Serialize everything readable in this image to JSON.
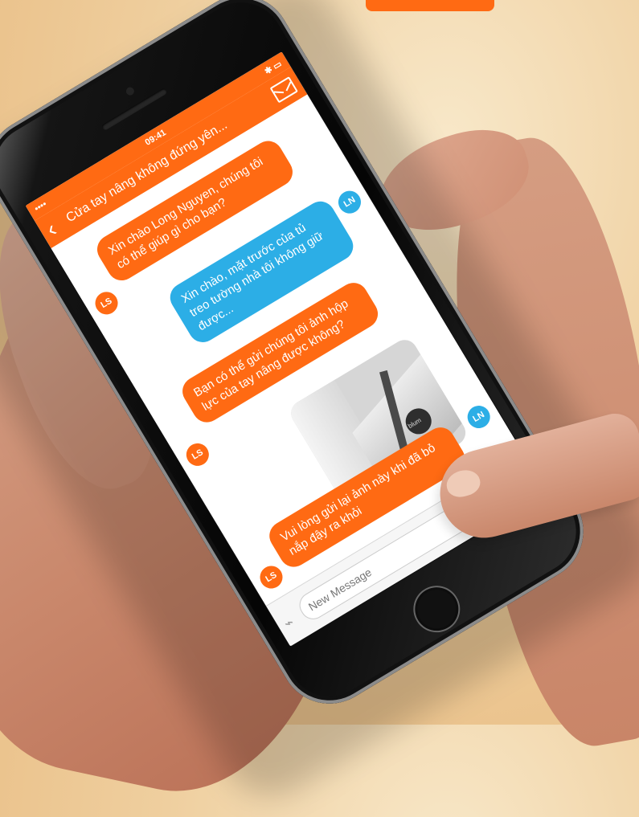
{
  "status": {
    "signal": "•••• ",
    "time": "09:41",
    "battery": "✱ ▭"
  },
  "header": {
    "back": "‹",
    "title": "Cửa tay nâng không đứng yên..."
  },
  "avatars": {
    "staff": "LS",
    "user": "LN"
  },
  "messages": [
    {
      "sender": "LS",
      "text": "Xin chào Long Nguyen, chúng tôi có thể giúp gì cho bạn?"
    },
    {
      "sender": "LN",
      "text": "Xin chào, mặt trước của tủ treo tường nhà tôi không giữ được..."
    },
    {
      "sender": "LS",
      "text": "Bạn có thể gửi chúng tôi ảnh hộp lực của tay nâng được không?"
    },
    {
      "sender": "LN",
      "image_label": "blum"
    },
    {
      "sender": "LS",
      "text": "Vui lòng gửi lại ảnh này khi đã bỏ nắp đậy ra khỏi"
    }
  ],
  "composer": {
    "placeholder": "New Message"
  },
  "colors": {
    "orange": "#ff6a13",
    "blue": "#2caee6"
  }
}
